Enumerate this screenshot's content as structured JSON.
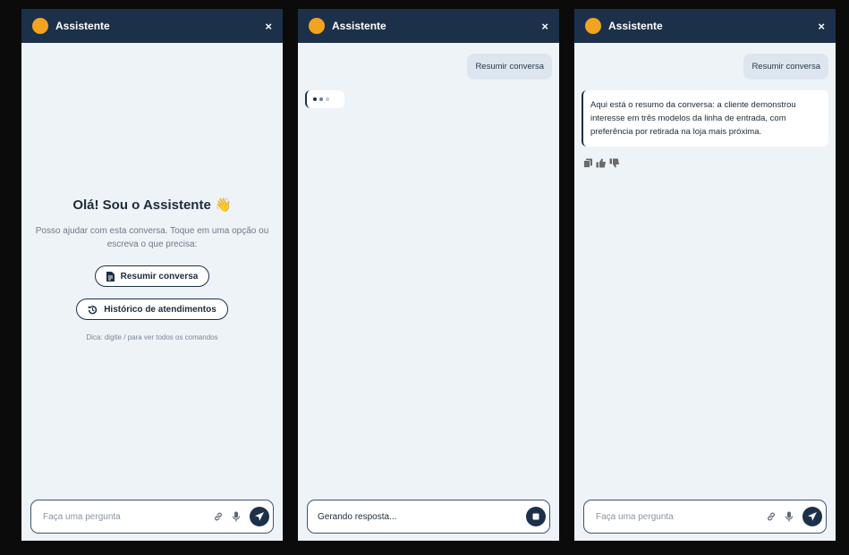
{
  "colors": {
    "header": "#1c3049",
    "avatar": "#f2a31f",
    "panel": "#eef3f8",
    "page": "#0b0b0b"
  },
  "panels": [
    {
      "header": {
        "title": "Assistente",
        "close": "×"
      },
      "welcome": {
        "heading": "Olá! Sou o Assistente",
        "emoji": "👋",
        "text": "Posso ajudar com esta conversa. Toque em uma opção ou escreva o que precisa:",
        "chips": [
          {
            "label": "Resumir conversa",
            "icon": "document-icon"
          },
          {
            "label": "Histórico de atendimentos",
            "icon": "history-icon"
          }
        ],
        "tip": "Dica: digite / para ver todos os comandos"
      },
      "input": {
        "placeholder": "Faça uma pergunta",
        "icons": [
          "link-icon",
          "mic-icon",
          "send-icon"
        ]
      }
    },
    {
      "header": {
        "title": "Assistente",
        "close": "×"
      },
      "user_message": "Resumir conversa",
      "typing_indicator": true,
      "input": {
        "status_text": "Gerando resposta...",
        "icons": [
          "stop-icon"
        ]
      }
    },
    {
      "header": {
        "title": "Assistente",
        "close": "×"
      },
      "user_message": "Resumir conversa",
      "bot_message": "Aqui está o resumo da conversa: a cliente demonstrou interesse em três modelos da linha de entrada, com preferência por retirada na loja mais próxima.",
      "actions": [
        "copy-icon",
        "thumbs-up-icon",
        "thumbs-down-icon"
      ],
      "input": {
        "placeholder": "Faça uma pergunta",
        "icons": [
          "link-icon",
          "mic-icon",
          "send-icon"
        ]
      }
    }
  ]
}
